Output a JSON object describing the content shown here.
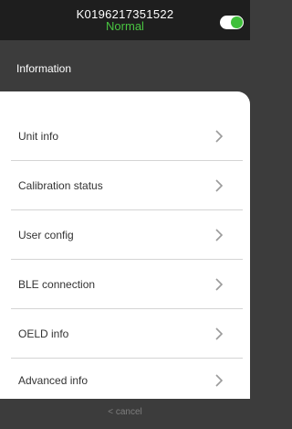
{
  "header": {
    "serial": "K0196217351522",
    "status": "Normal",
    "toggle_on": true
  },
  "section": {
    "title": "Information"
  },
  "menu": [
    {
      "label": "Unit info"
    },
    {
      "label": "Calibration status"
    },
    {
      "label": "User config"
    },
    {
      "label": "BLE connection"
    },
    {
      "label": "OELD info"
    },
    {
      "label": "Advanced info"
    }
  ],
  "footer": {
    "cancel": "< cancel"
  },
  "colors": {
    "topbar": "#1e1e1e",
    "background": "#3c3c3c",
    "status_green": "#49c541",
    "toggle_knob": "#3fbf3a"
  }
}
